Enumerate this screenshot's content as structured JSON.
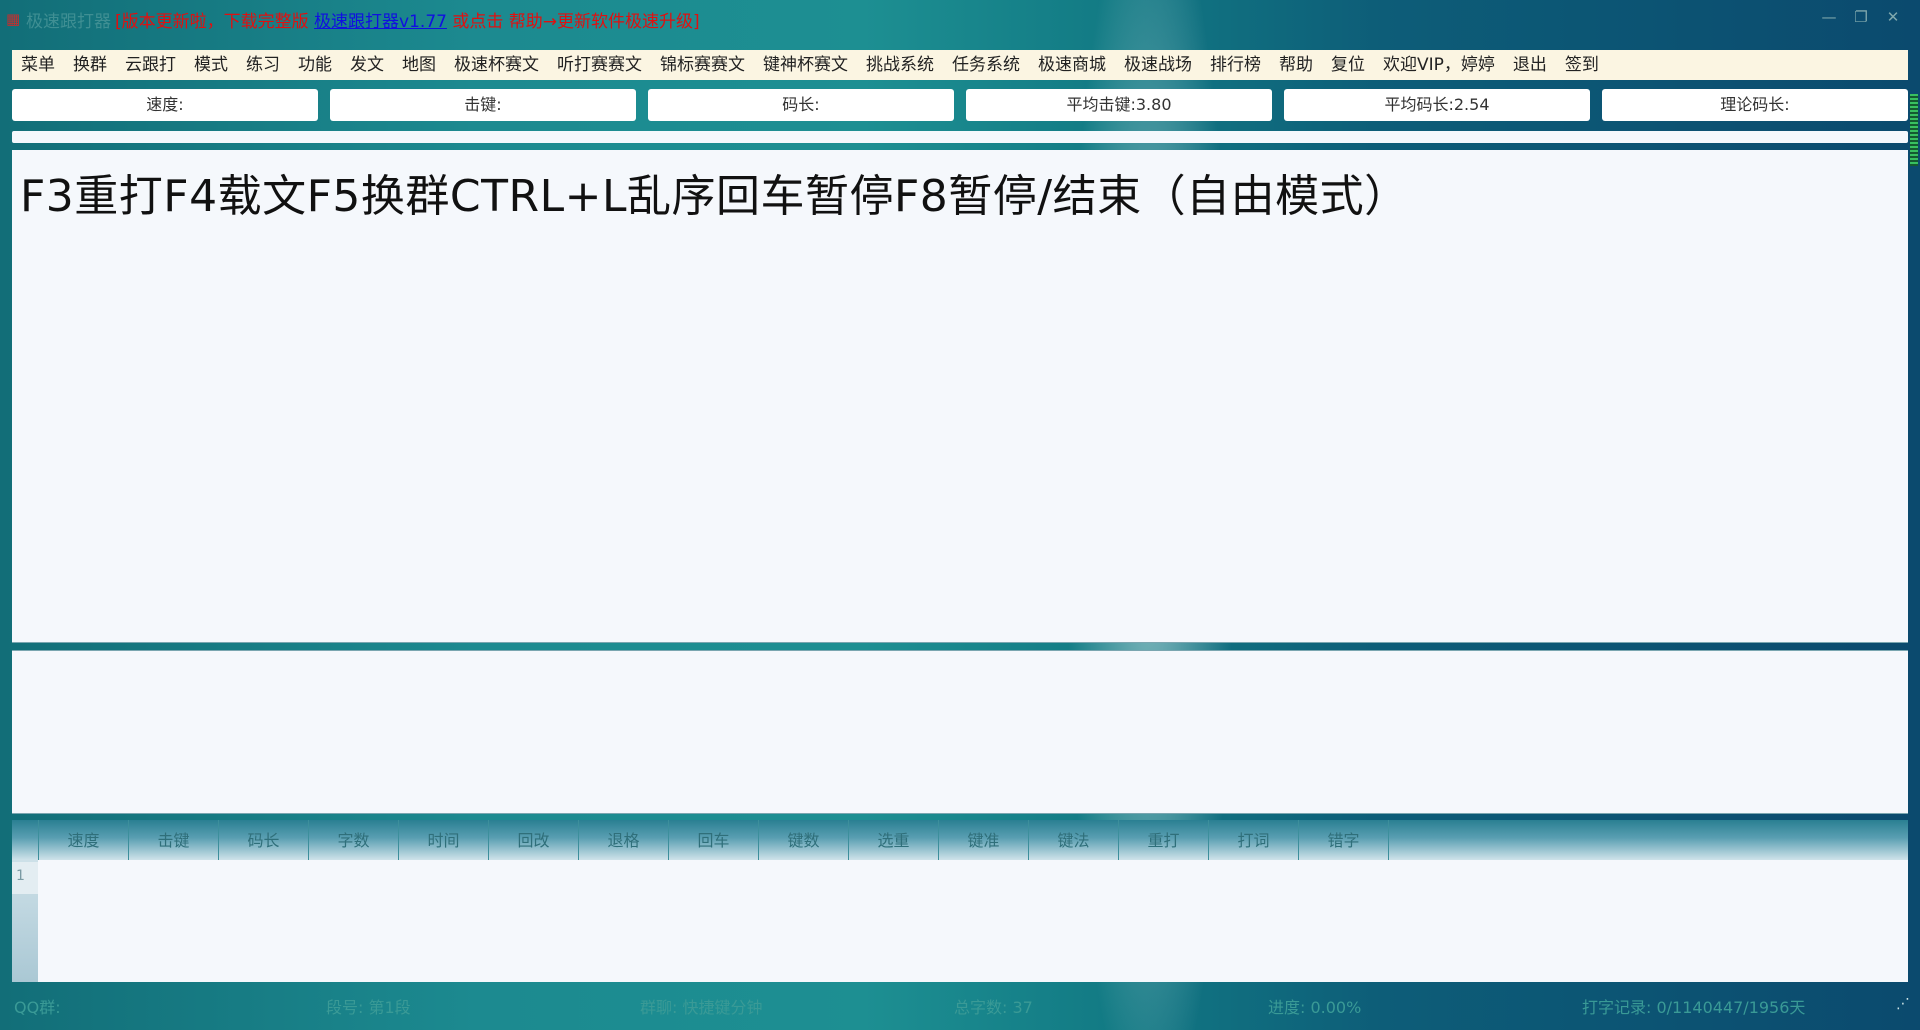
{
  "titlebar": {
    "prefix": "极速跟打器",
    "part1": "[版本更新啦，下载完整版 ",
    "link": "极速跟打器v1.77",
    "part2": " 或点击 帮助→更新软件极速升级]",
    "window_buttons": [
      "minimize-icon",
      "restore-icon",
      "close-icon"
    ]
  },
  "menu": [
    "菜单",
    "换群",
    "云跟打",
    "模式",
    "练习",
    "功能",
    "发文",
    "地图",
    "极速杯赛文",
    "听打赛赛文",
    "锦标赛赛文",
    "键神杯赛文",
    "挑战系统",
    "任务系统",
    "极速商城",
    "极速战场",
    "排行榜",
    "帮助",
    "复位",
    "欢迎VIP，婷婷",
    "退出",
    "签到"
  ],
  "stats": [
    {
      "label": "速度:"
    },
    {
      "label": "击键:"
    },
    {
      "label": "码长:"
    },
    {
      "label": "平均击键:3.80"
    },
    {
      "label": "平均码长:2.54"
    },
    {
      "label": "理论码长:"
    }
  ],
  "sample_text": "F3重打F4载文F5换群CTRL+L乱序回车暂停F8暂停/结束（自由模式）",
  "grid": {
    "columns": [
      "速度",
      "击键",
      "码长",
      "字数",
      "时间",
      "回改",
      "退格",
      "回车",
      "键数",
      "选重",
      "键准",
      "键法",
      "重打",
      "打词",
      "错字"
    ],
    "row_number": "1"
  },
  "status": {
    "qq": "QQ群:",
    "para": "段号: 第1段",
    "group": "群聊: 快捷键分钟",
    "count": "总字数: 37",
    "progress": "进度: 0.00%",
    "record": "打字记录: 0/1140447/1956天"
  },
  "colors": {
    "menu_bg": "#fbf5e2",
    "title_red": "#e01010",
    "title_link": "#1010e0"
  }
}
